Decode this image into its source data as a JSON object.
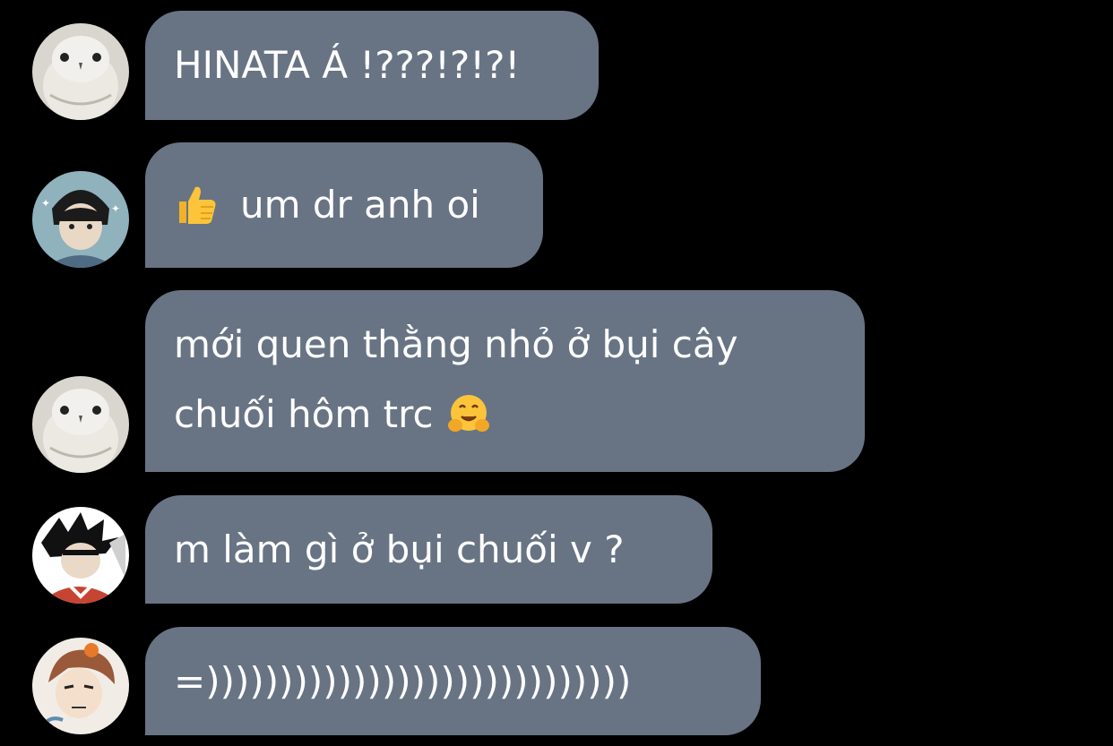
{
  "messages": [
    {
      "id": "m1",
      "sender": "owl-avatar",
      "text": "HINATA Á !???!?!?!"
    },
    {
      "id": "m2",
      "sender": "akaashi-avatar",
      "emoji": "thumbs-up-icon",
      "text": "um dr anh oi"
    },
    {
      "id": "m3",
      "sender": "owl-avatar",
      "line1": "mới quen thằng nhỏ ở bụi cây",
      "line2": "chuối hôm trc",
      "emoji": "hugging-face-icon"
    },
    {
      "id": "m4",
      "sender": "kuroo-avatar",
      "text": "m làm gì ở bụi chuối v ?"
    },
    {
      "id": "m5",
      "sender": "tanaka-avatar",
      "text": "=)))))))))))))))))))))))))))))"
    }
  ],
  "colors": {
    "background": "#000000",
    "bubble": "#687484",
    "text": "#ffffff"
  }
}
